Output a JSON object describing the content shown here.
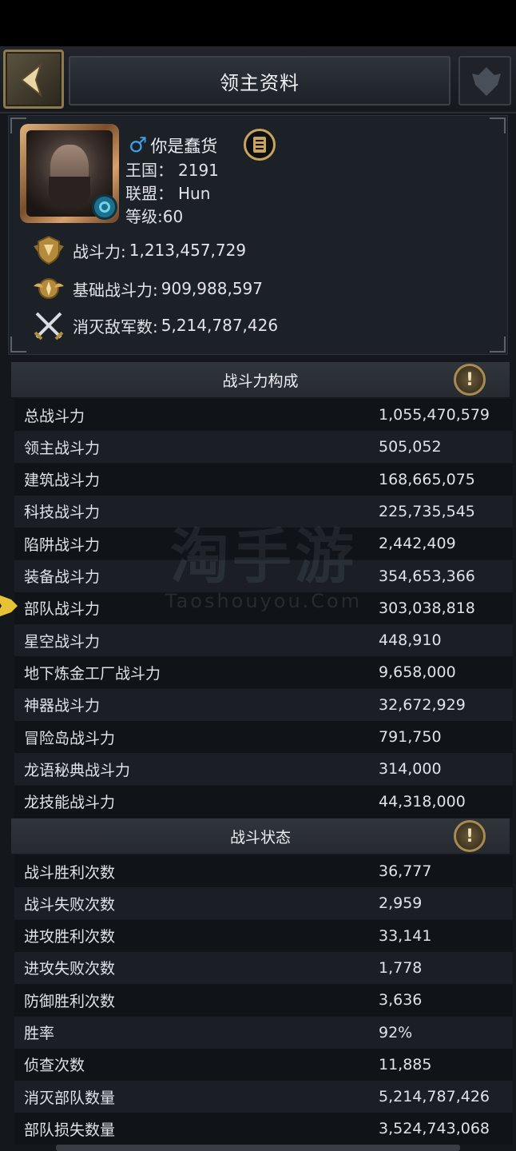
{
  "header": {
    "title": "领主资料",
    "back_icon": "chevron-left-icon",
    "emblem_icon": "alliance-emblem-icon"
  },
  "profile": {
    "name": "你是蠢货",
    "gender_symbol": "♂",
    "kingdom_label": "王国：",
    "kingdom_value": "2191",
    "alliance_label": "联盟：",
    "alliance_value": "Hun",
    "level_label": "等级:",
    "level_value": "60",
    "stats": [
      {
        "label": "战斗力:",
        "value": "1,213,457,729",
        "icon": "shield-wings-icon"
      },
      {
        "label": "基础战斗力:",
        "value": "909,988,597",
        "icon": "winged-emblem-icon"
      },
      {
        "label": "消灭敌军数:",
        "value": "5,214,787,426",
        "icon": "crossed-swords-icon"
      }
    ]
  },
  "power_section": {
    "title": "战斗力构成",
    "rows": [
      {
        "label": "总战斗力",
        "value": "1,055,470,579"
      },
      {
        "label": "领主战斗力",
        "value": "505,052"
      },
      {
        "label": "建筑战斗力",
        "value": "168,665,075"
      },
      {
        "label": "科技战斗力",
        "value": "225,735,545"
      },
      {
        "label": "陷阱战斗力",
        "value": "2,442,409"
      },
      {
        "label": "装备战斗力",
        "value": "354,653,366"
      },
      {
        "label": "部队战斗力",
        "value": "303,038,818"
      },
      {
        "label": "星空战斗力",
        "value": "448,910"
      },
      {
        "label": "地下炼金工厂战斗力",
        "value": "9,658,000"
      },
      {
        "label": "神器战斗力",
        "value": "32,672,929"
      },
      {
        "label": "冒险岛战斗力",
        "value": "791,750"
      },
      {
        "label": "龙语秘典战斗力",
        "value": "314,000"
      },
      {
        "label": "龙技能战斗力",
        "value": "44,318,000"
      }
    ]
  },
  "battle_section": {
    "title": "战斗状态",
    "rows": [
      {
        "label": "战斗胜利次数",
        "value": "36,777"
      },
      {
        "label": "战斗失败次数",
        "value": "2,959"
      },
      {
        "label": "进攻胜利次数",
        "value": "33,141"
      },
      {
        "label": "进攻失败次数",
        "value": "1,778"
      },
      {
        "label": "防御胜利次数",
        "value": "3,636"
      },
      {
        "label": "胜率",
        "value": "92%"
      },
      {
        "label": "侦查次数",
        "value": "11,885"
      },
      {
        "label": "消灭部队数量",
        "value": "5,214,787,426"
      },
      {
        "label": "部队损失数量",
        "value": "3,524,743,068"
      }
    ]
  },
  "info_button_symbol": "!",
  "watermark": {
    "main": "淘手游",
    "sub": "Taoshouyou.Com"
  }
}
